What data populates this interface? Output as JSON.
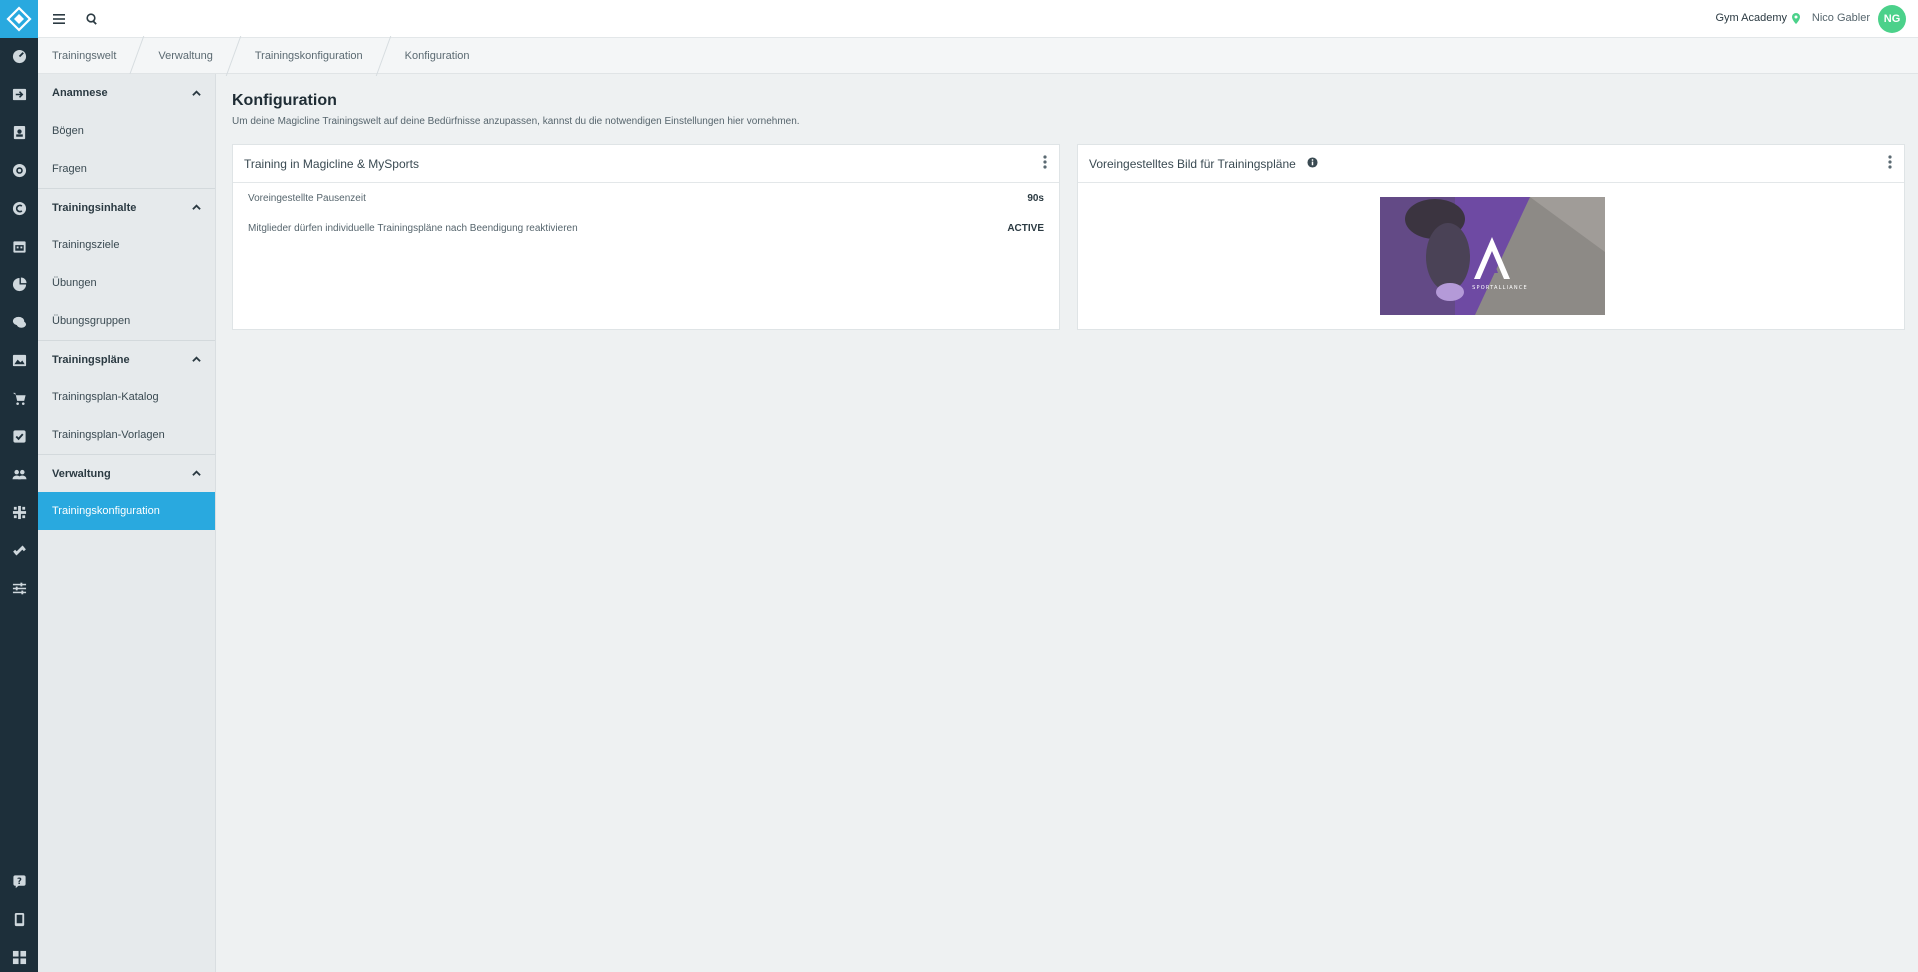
{
  "header": {
    "studio": "Gym Academy",
    "user_name": "Nico Gabler",
    "user_initials": "NG"
  },
  "breadcrumb": [
    "Trainingswelt",
    "Verwaltung",
    "Trainingskonfiguration",
    "Konfiguration"
  ],
  "subnav": {
    "groups": [
      {
        "title": "Anamnese",
        "items": [
          "Bögen",
          "Fragen"
        ]
      },
      {
        "title": "Trainingsinhalte",
        "items": [
          "Trainingsziele",
          "Übungen",
          "Übungsgruppen"
        ]
      },
      {
        "title": "Trainingspläne",
        "items": [
          "Trainingsplan-Katalog",
          "Trainingsplan-Vorlagen"
        ]
      },
      {
        "title": "Verwaltung",
        "items": [
          "Trainingskonfiguration"
        ]
      }
    ],
    "active_item": "Trainingskonfiguration"
  },
  "main": {
    "title": "Konfiguration",
    "description": "Um deine Magicline Trainingswelt auf deine Bedürfnisse anzupassen, kannst du die notwendigen Einstellungen hier vornehmen.",
    "card_training": {
      "title": "Training in Magicline & MySports",
      "rows": [
        {
          "label": "Voreingestellte Pausenzeit",
          "value": "90s"
        },
        {
          "label": "Mitglieder dürfen individuelle Trainingspläne nach Beendigung reaktivieren",
          "value": "ACTIVE"
        }
      ]
    },
    "card_image": {
      "title": "Voreingestelltes Bild für Trainingspläne",
      "image_caption": "SPORTALLIANCE"
    }
  },
  "colors": {
    "rail": "#1d2f3a",
    "accent": "#29a9df",
    "avatar": "#4bd18a",
    "location_pin": "#4bd18a"
  },
  "icons": {
    "rail": [
      "dashboard-icon",
      "checkin-icon",
      "contact-icon",
      "settings-gear-icon",
      "finance-icon",
      "calendar-icon",
      "analytics-icon",
      "chat-icon",
      "gallery-icon",
      "shop-icon",
      "tasks-icon",
      "members-icon",
      "network-icon",
      "training-dumbbell-icon",
      "sliders-icon",
      "help-icon",
      "device-icon",
      "apps-grid-icon"
    ]
  }
}
